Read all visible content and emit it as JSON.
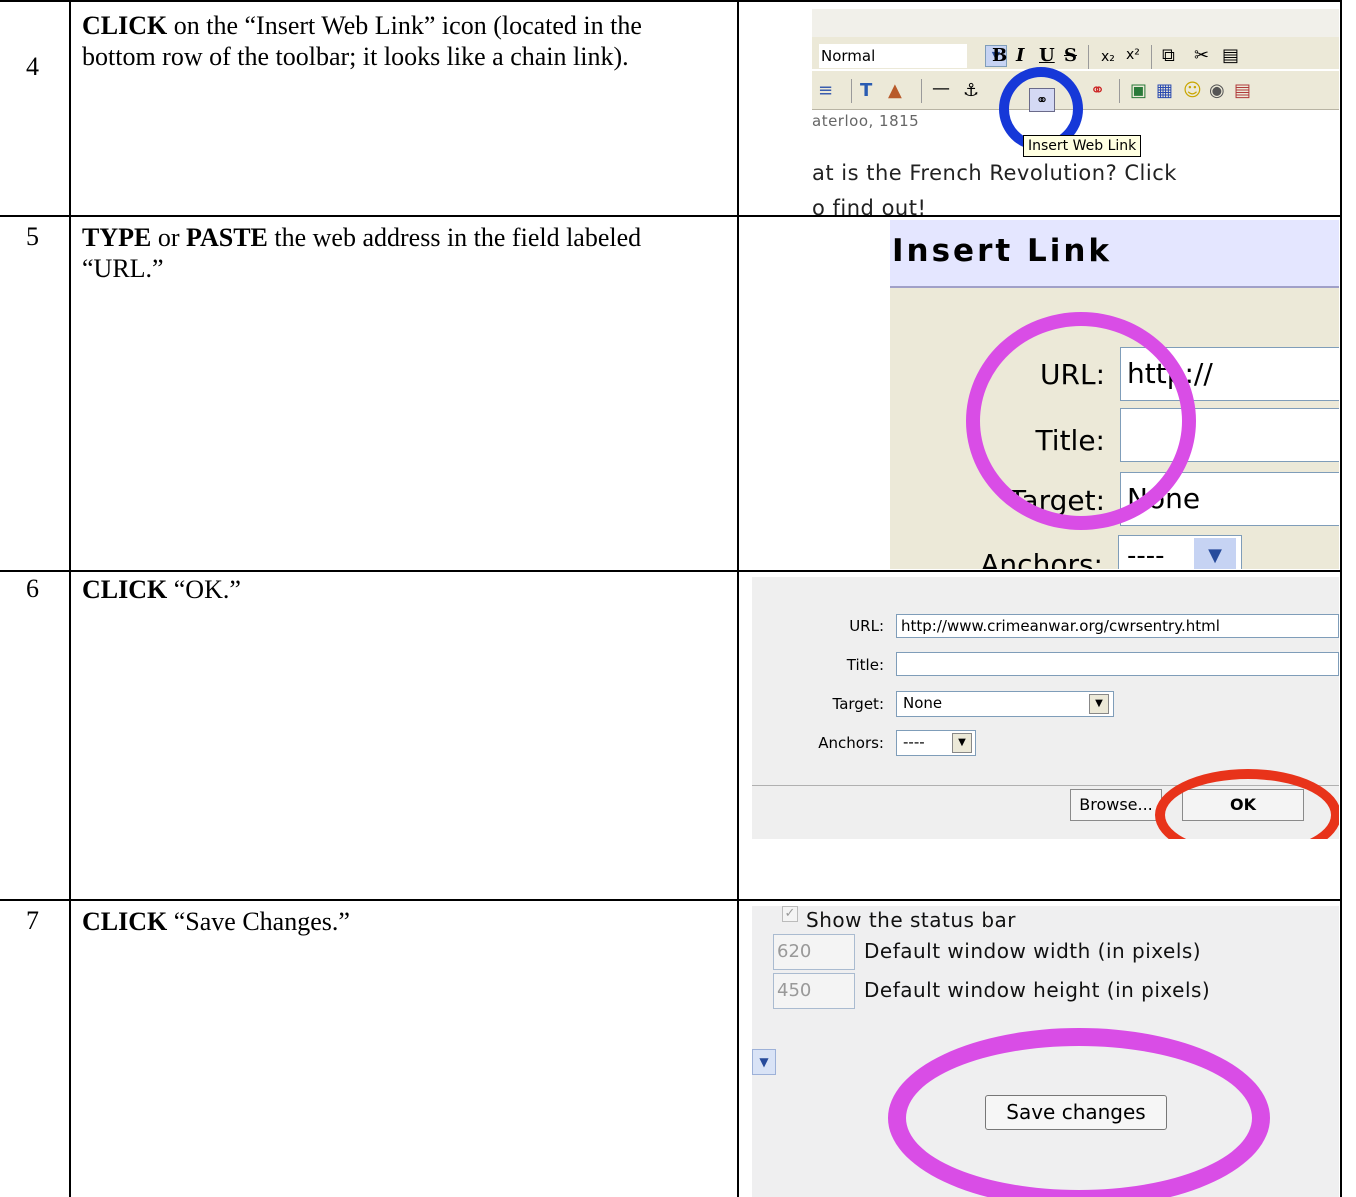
{
  "rows": [
    {
      "number": "4",
      "instruction": {
        "lead": "CLICK",
        "rest": " on the “Insert Web Link” icon (located in the bottom row of the toolbar; it looks like a chain link)."
      }
    },
    {
      "number": "5",
      "instruction": {
        "lead": "TYPE",
        "mid": " or ",
        "lead2": "PASTE",
        "rest": " the web address in the field labeled “URL.”"
      }
    },
    {
      "number": "6",
      "instruction": {
        "lead": "CLICK",
        "rest": " “OK.”"
      }
    },
    {
      "number": "7",
      "instruction": {
        "lead": "CLICK",
        "rest": " “Save Changes.”"
      }
    }
  ],
  "shot4": {
    "format_select": "Normal",
    "tooltip": "Insert Web Link",
    "doc_line1": "aterloo, 1815",
    "doc_line2": "at is the French Revolution? Click",
    "doc_line3": "o find out!",
    "icons": [
      "bold-icon",
      "italic-icon",
      "underline-icon",
      "strikethrough-icon",
      "subscript-icon",
      "superscript-icon",
      "copy-icon",
      "cut-icon",
      "paste-icon",
      "indent-icon",
      "text-color-icon",
      "background-color-icon",
      "horizontal-rule-icon",
      "anchor-icon",
      "insert-web-link-icon",
      "remove-link-icon",
      "image-icon",
      "table-icon",
      "smiley-icon",
      "media-icon",
      "paste-word-icon"
    ],
    "highlight_color": "#1638d8"
  },
  "shot5": {
    "title": "Insert Link",
    "url_label": "URL:",
    "url_value": "http://",
    "title_label": "Title:",
    "title_value": "",
    "target_label": "Target:",
    "target_value": "None",
    "anchors_label": "Anchors:",
    "anchors_value": "----",
    "highlight_color": "#d94de6"
  },
  "shot6": {
    "url_label": "URL:",
    "url_value": "http://www.crimeanwar.org/cwrsentry.html",
    "title_label": "Title:",
    "title_value": "",
    "target_label": "Target:",
    "target_value": "None",
    "anchors_label": "Anchors:",
    "anchors_value": "----",
    "browse_label": "Browse...",
    "ok_label": "OK",
    "highlight_color": "#e8331a"
  },
  "shot7": {
    "status_bar_label": "Show the status bar",
    "status_bar_checked": true,
    "width_value": "620",
    "width_label": "Default window width (in pixels)",
    "height_value": "450",
    "height_label": "Default window height (in pixels)",
    "save_label": "Save changes",
    "highlight_color": "#d94de6"
  }
}
